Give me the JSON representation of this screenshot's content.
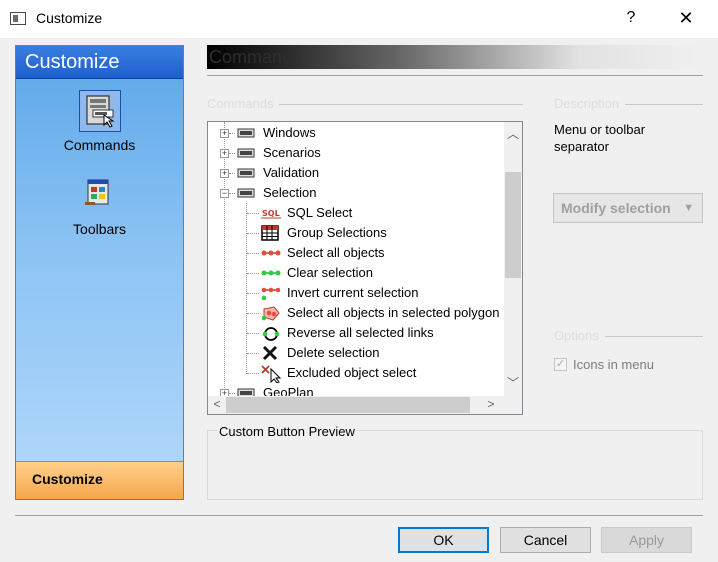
{
  "window": {
    "title": "Customize",
    "help_glyph": "?",
    "close_glyph": "✕"
  },
  "sidebar": {
    "header": "Customize",
    "items": [
      {
        "label": "Commands",
        "icon": "commands-icon",
        "selected": true
      },
      {
        "label": "Toolbars",
        "icon": "toolbars-icon",
        "selected": false
      }
    ],
    "footer": "Customize"
  },
  "section": {
    "title": "Commands"
  },
  "commands_group": {
    "label": "Commands"
  },
  "tree": [
    {
      "label": "Windows",
      "expander": "+",
      "icon": "menu-bar-icon"
    },
    {
      "label": "Scenarios",
      "expander": "+",
      "icon": "menu-bar-icon"
    },
    {
      "label": "Validation",
      "expander": "+",
      "icon": "menu-bar-icon"
    },
    {
      "label": "Selection",
      "expander": "−",
      "icon": "menu-bar-icon"
    },
    {
      "label": "SQL Select",
      "icon": "sql-icon",
      "icon_text": "SQL"
    },
    {
      "label": "Group Selections",
      "icon": "table-grid-icon"
    },
    {
      "label": "Select all objects",
      "icon": "select-all-objects-icon"
    },
    {
      "label": "Clear selection",
      "icon": "clear-selection-icon"
    },
    {
      "label": "Invert current selection",
      "icon": "invert-selection-icon"
    },
    {
      "label": "Select all objects in selected polygon",
      "icon": "polygon-select-icon"
    },
    {
      "label": "Reverse all selected links",
      "icon": "reverse-links-icon"
    },
    {
      "label": "Delete selection",
      "icon": "delete-x-icon"
    },
    {
      "label": "Excluded object select",
      "icon": "excluded-select-icon"
    },
    {
      "label": "GeoPlan",
      "expander": "+",
      "icon": "menu-bar-icon"
    }
  ],
  "description": {
    "label": "Description",
    "text": "Menu or toolbar separator",
    "modify_button": "Modify selection",
    "dropdown_glyph": "▼"
  },
  "options": {
    "label": "Options",
    "icons_in_menu": "Icons in menu",
    "icons_in_menu_checked": true
  },
  "preview": {
    "label": "Custom Button Preview"
  },
  "scroll": {
    "up": "︿",
    "down": "﹀",
    "left": "<",
    "right": ">"
  },
  "buttons": {
    "ok": "OK",
    "cancel": "Cancel",
    "apply": "Apply"
  }
}
